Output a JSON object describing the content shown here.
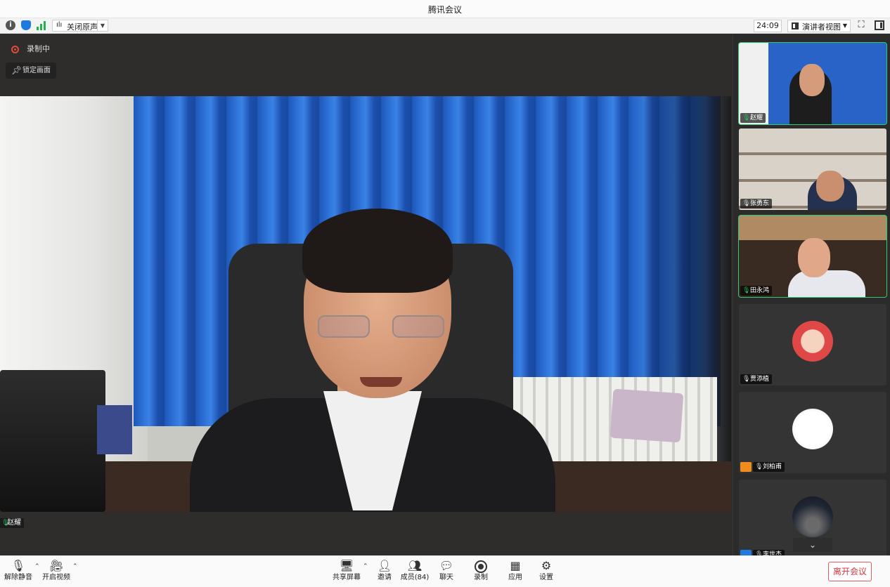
{
  "window": {
    "title": "腾讯会议"
  },
  "toolbar": {
    "noise_label": "关闭原声",
    "timer": "24:09",
    "view_label": "演讲者视图"
  },
  "stage": {
    "recording_label": "录制中",
    "lock_label": "锁定画面",
    "speaker_name": "赵耀"
  },
  "participants": [
    {
      "name": "赵耀",
      "mic": "on"
    },
    {
      "name": "张勇东",
      "mic": "off"
    },
    {
      "name": "田永鸿",
      "mic": "on"
    },
    {
      "name": "贾添植",
      "mic": "off"
    },
    {
      "name": "刘柏甫",
      "mic": "off"
    },
    {
      "name": "李世杰",
      "mic": "off"
    }
  ],
  "bottombar": {
    "unmute_label": "解除静音",
    "video_label": "开启视频",
    "share_label": "共享屏幕",
    "invite_label": "邀请",
    "members_label": "成员(84)",
    "chat_label": "聊天",
    "record_label": "录制",
    "apps_label": "应用",
    "settings_label": "设置",
    "leave_label": "离开会议"
  },
  "colors": {
    "accent_green": "#22c55e",
    "leave_red": "#d9363e",
    "recording_red": "#e24a3a"
  }
}
